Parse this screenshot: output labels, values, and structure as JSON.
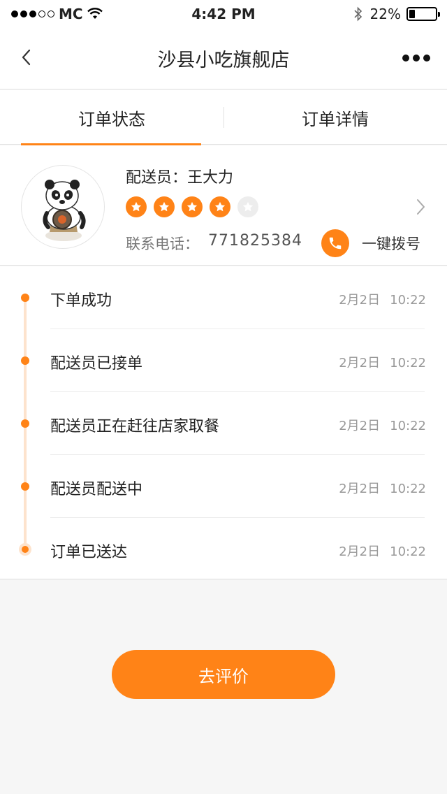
{
  "status_bar": {
    "carrier": "MC",
    "time": "4:42 PM",
    "battery": "22%"
  },
  "nav": {
    "title": "沙县小吃旗舰店"
  },
  "tabs": [
    {
      "label": "订单状态",
      "active": true
    },
    {
      "label": "订单详情",
      "active": false
    }
  ],
  "courier": {
    "name": "配送员：王大力",
    "rating": 4,
    "rating_max": 5,
    "phone_label": "联系电话：",
    "phone": "771825384",
    "call_label": "一键拨号"
  },
  "timeline": [
    {
      "text": "下单成功",
      "date": "2月2日",
      "time": "10:22"
    },
    {
      "text": "配送员已接单",
      "date": "2月2日",
      "time": "10:22"
    },
    {
      "text": "配送员正在赶往店家取餐",
      "date": "2月2日",
      "time": "10:22"
    },
    {
      "text": "配送员配送中",
      "date": "2月2日",
      "time": "10:22"
    },
    {
      "text": "订单已送达",
      "date": "2月2日",
      "time": "10:22"
    }
  ],
  "actions": {
    "review_label": "去评价"
  },
  "colors": {
    "accent": "#ff8317",
    "accent_light": "#fde3cd"
  }
}
